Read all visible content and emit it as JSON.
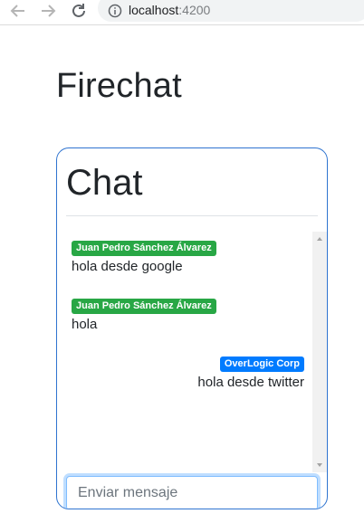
{
  "browser": {
    "url_host": "localhost",
    "url_port": ":4200",
    "icons": [
      "back-arrow",
      "forward-arrow",
      "reload",
      "info"
    ]
  },
  "page": {
    "title": "Firechat"
  },
  "chat": {
    "heading": "Chat",
    "messages": [
      {
        "author": "Juan Pedro Sánchez Álvarez",
        "text": "hola desde google",
        "align": "left",
        "badge_color": "#28a745"
      },
      {
        "author": "Juan Pedro Sánchez Álvarez",
        "text": "hola",
        "align": "left",
        "badge_color": "#28a745"
      },
      {
        "author": "OverLogic Corp",
        "text": "hola desde twitter",
        "align": "right",
        "badge_color": "#007bff"
      }
    ],
    "input": {
      "placeholder": "Enviar mensaje",
      "value": ""
    }
  },
  "colors": {
    "card_border": "#2f74d0",
    "green_badge": "#28a745",
    "blue_badge": "#007bff"
  }
}
